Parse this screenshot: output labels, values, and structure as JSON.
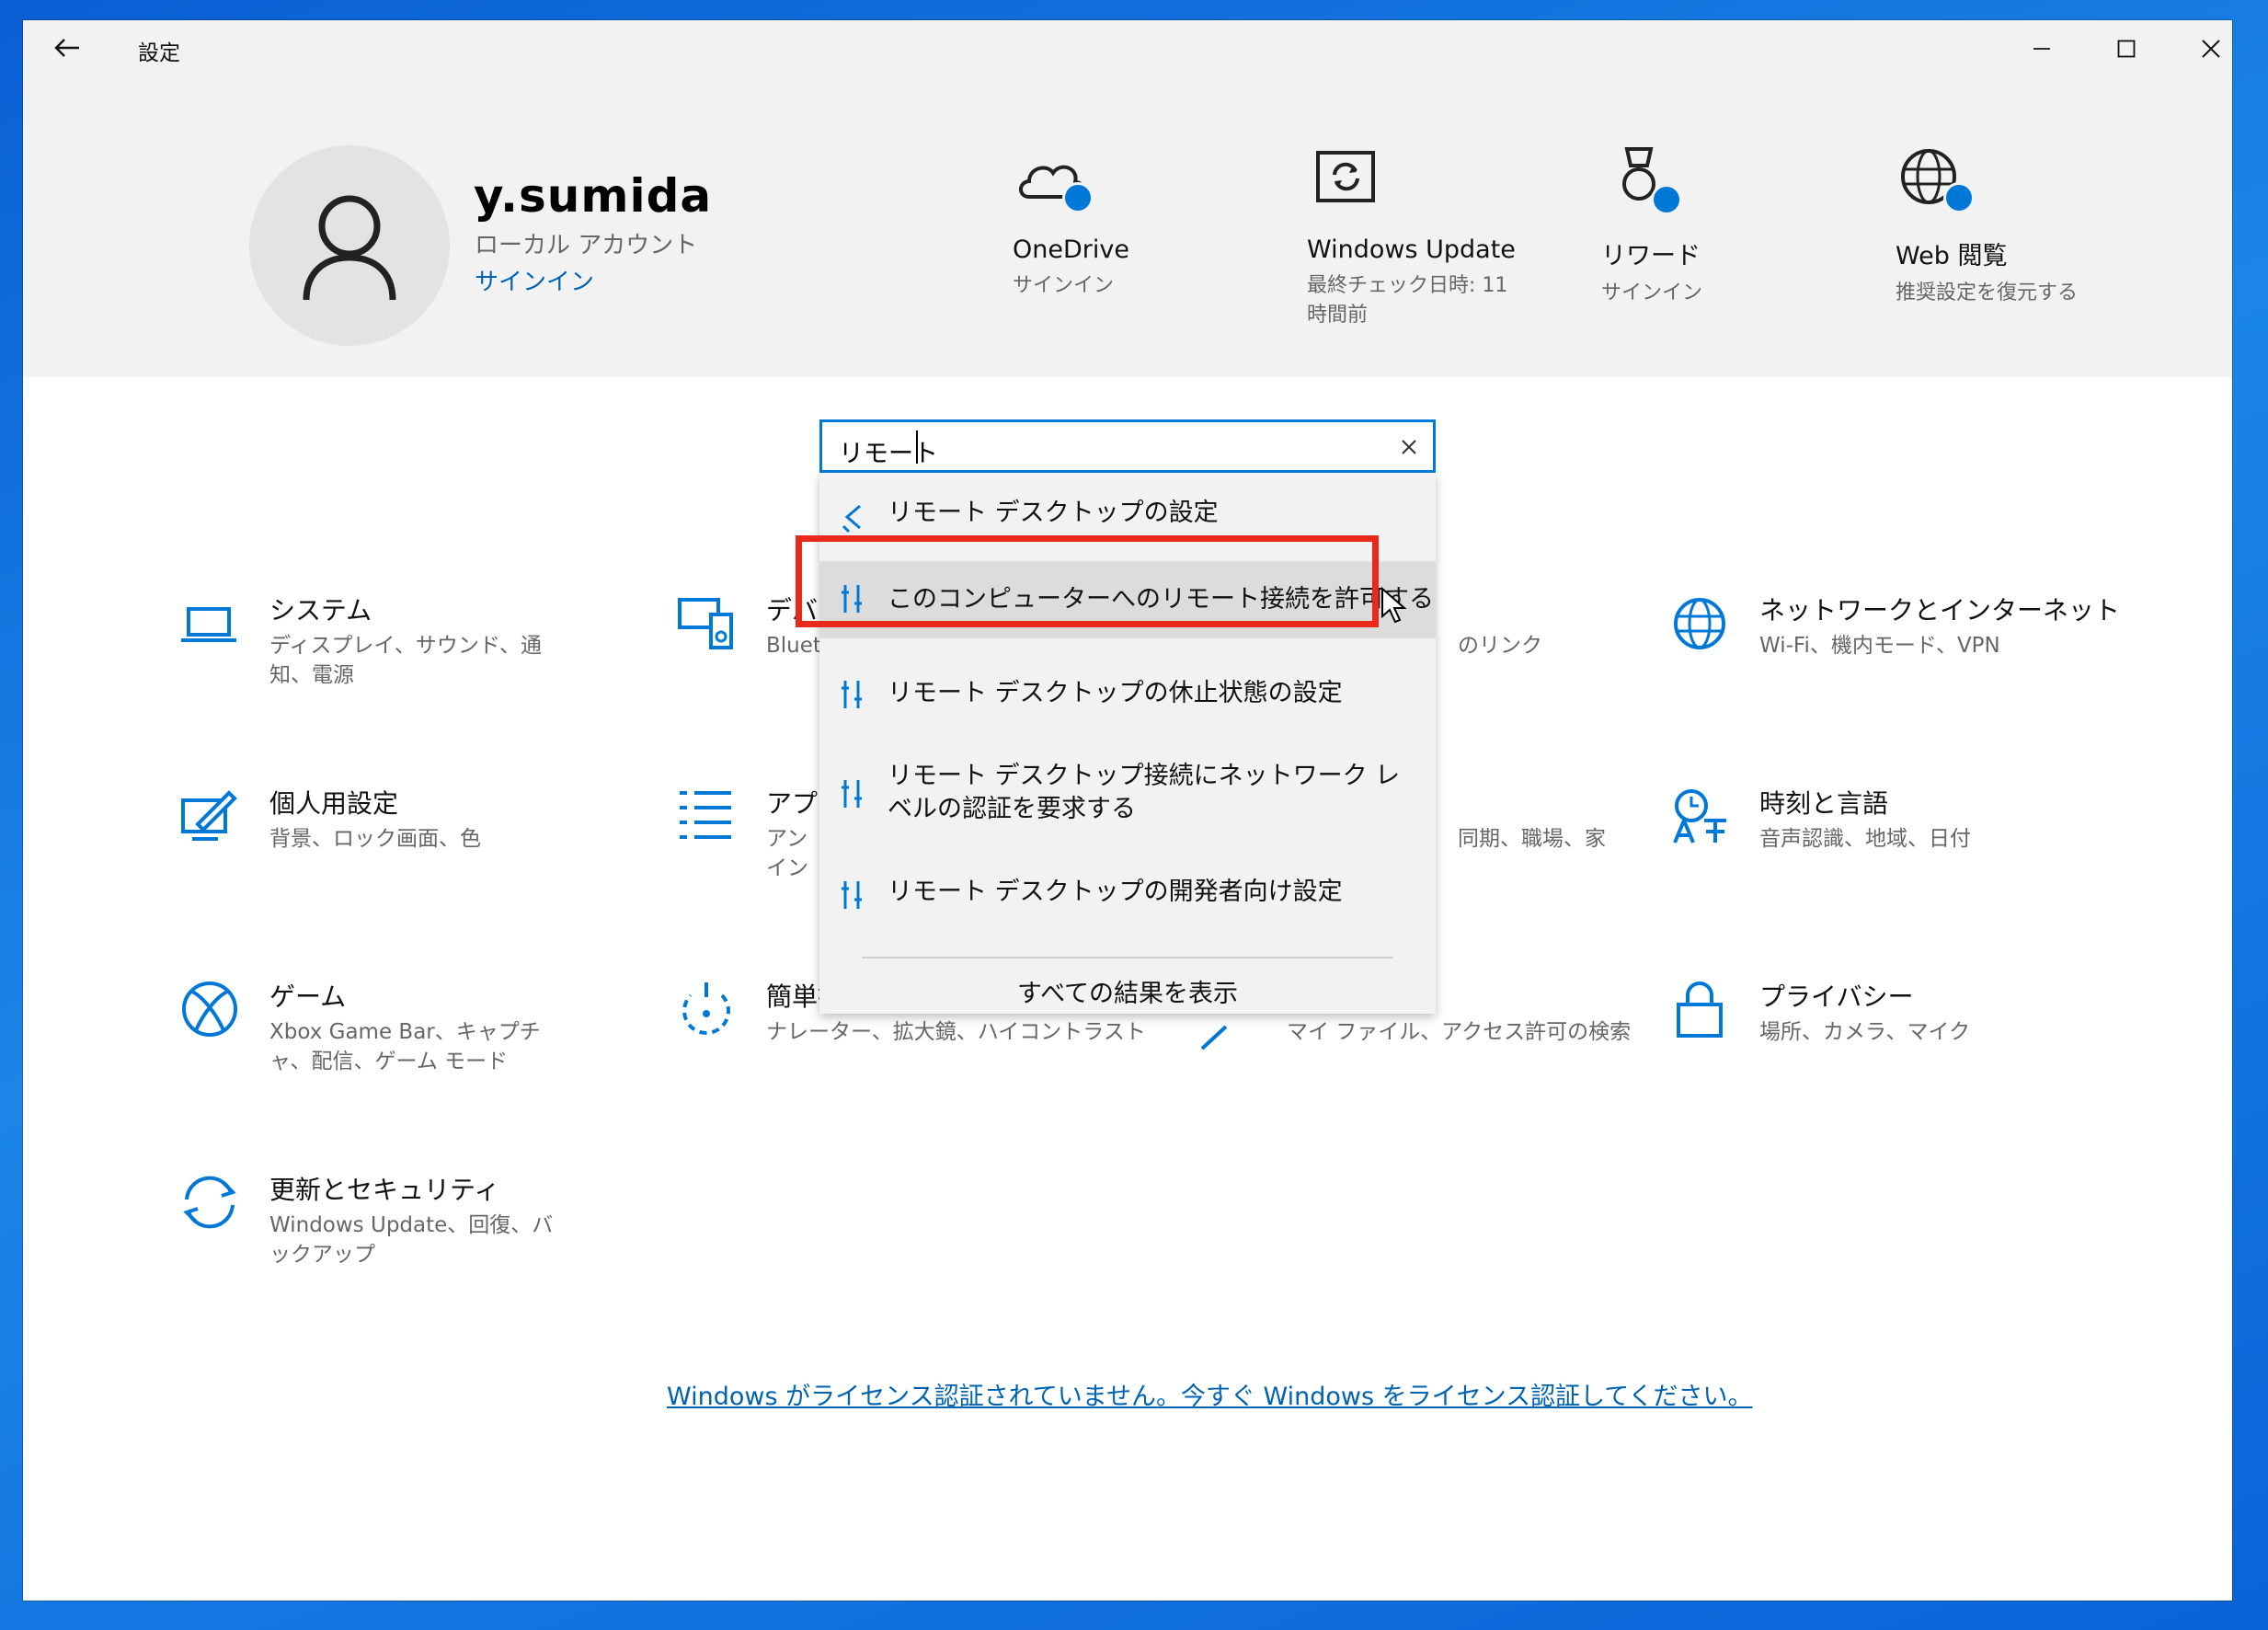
{
  "window": {
    "title": "設定"
  },
  "user": {
    "name": "y.sumida",
    "account_type": "ローカル アカウント",
    "signin": "サインイン"
  },
  "tiles": [
    {
      "title": "OneDrive",
      "sub": "サインイン",
      "icon": "onedrive-icon"
    },
    {
      "title": "Windows Update",
      "sub": "最終チェック日時: 11 時間前",
      "icon": "windows-update-icon"
    },
    {
      "title": "リワード",
      "sub": "サインイン",
      "icon": "rewards-icon"
    },
    {
      "title": "Web 閲覧",
      "sub": "推奨設定を復元する",
      "icon": "globe-icon"
    }
  ],
  "search": {
    "value": "リモート",
    "results": [
      {
        "label": "リモート デスクトップの設定",
        "icon": "remote-desktop-icon"
      },
      {
        "label": "このコンピューターへのリモート接続を許可する",
        "icon": "settings-tool-icon"
      },
      {
        "label": "リモート デスクトップの休止状態の設定",
        "icon": "settings-tool-icon"
      },
      {
        "label": "リモート デスクトップ接続にネットワーク レベルの認証を要求する",
        "icon": "settings-tool-icon"
      },
      {
        "label": "リモート デスクトップの開発者向け設定",
        "icon": "settings-tool-icon"
      }
    ],
    "show_all": "すべての結果を表示"
  },
  "categories": [
    {
      "title": "システム",
      "desc": "ディスプレイ、サウンド、通知、電源",
      "icon": "laptop-icon"
    },
    {
      "title": "デバイス",
      "desc": "Bluetooth",
      "icon": "devices-icon"
    },
    {
      "title": "",
      "desc": "のリンク",
      "icon": ""
    },
    {
      "title": "ネットワークとインターネット",
      "desc": "Wi-Fi、機内モード、VPN",
      "icon": "network-globe-icon"
    },
    {
      "title": "個人用設定",
      "desc": "背景、ロック画面、色",
      "icon": "personalization-icon"
    },
    {
      "title": "アプリ",
      "desc": "アンインストール の既定",
      "icon": "apps-icon"
    },
    {
      "title": "",
      "desc": "同期、職場、家",
      "icon": ""
    },
    {
      "title": "時刻と言語",
      "desc": "音声認識、地域、日付",
      "icon": "time-language-icon"
    },
    {
      "title": "ゲーム",
      "desc": "Xbox Game Bar、キャプチャ、配信、ゲーム モード",
      "icon": "xbox-icon"
    },
    {
      "title": "簡単操作",
      "desc": "ナレーター、拡大鏡、ハイコントラスト",
      "icon": "ease-of-access-icon"
    },
    {
      "title": "",
      "desc": "マイ ファイル、アクセス許可の検索",
      "icon": ""
    },
    {
      "title": "プライバシー",
      "desc": "場所、カメラ、マイク",
      "icon": "lock-icon"
    },
    {
      "title": "更新とセキュリティ",
      "desc": "Windows Update、回復、バックアップ",
      "icon": "update-security-icon"
    }
  ],
  "license_link": "Windows がライセンス認証されていません。今すぐ Windows をライセンス認証してください。",
  "colors": {
    "accent": "#0078d7",
    "highlight": "#e8291c"
  }
}
